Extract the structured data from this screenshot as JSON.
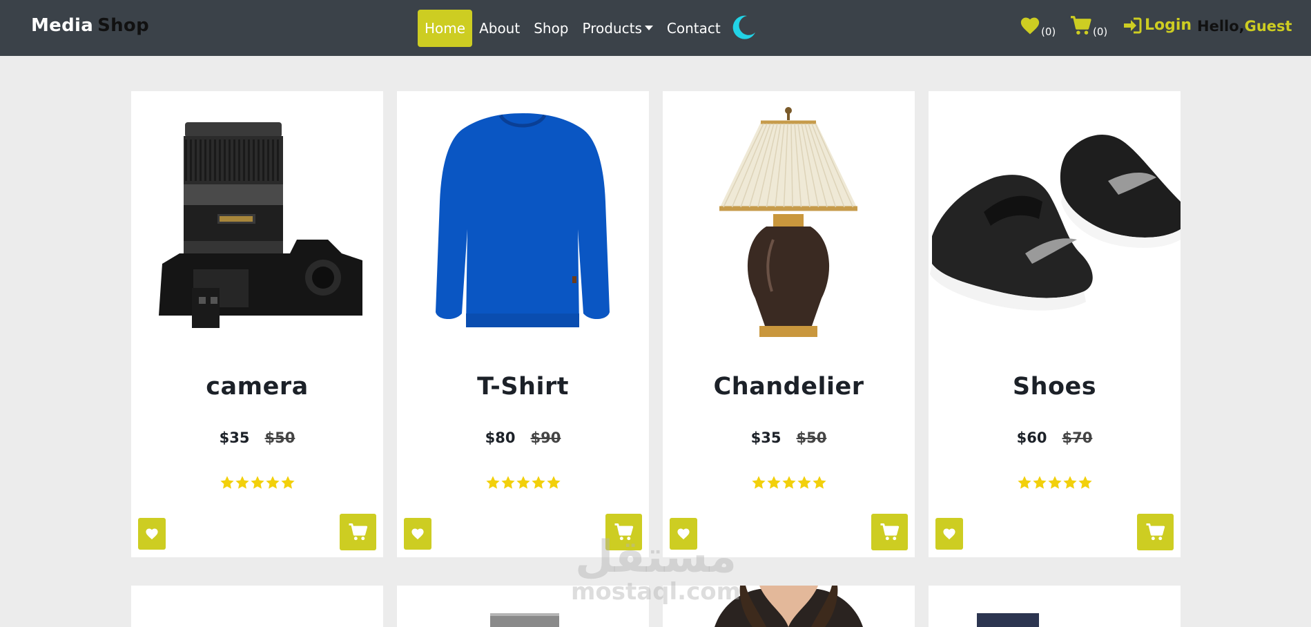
{
  "navbar": {
    "brand_part1": "Media",
    "brand_part2": "Shop",
    "links": [
      {
        "label": "Home",
        "active": true
      },
      {
        "label": "About"
      },
      {
        "label": "Shop"
      },
      {
        "label": "Products",
        "dropdown": true
      },
      {
        "label": "Contact"
      }
    ],
    "theme_icon": "moon-icon",
    "wishlist_count": "(0)",
    "cart_count": "(0)",
    "login_label": "Login",
    "greeting_prefix": "Hello,",
    "greeting_name": "Guest"
  },
  "products": [
    {
      "name": "camera",
      "price": "$35",
      "old_price": "$50",
      "rating": 5,
      "image": "camera"
    },
    {
      "name": "T-Shirt",
      "price": "$80",
      "old_price": "$90",
      "rating": 5,
      "image": "sweater"
    },
    {
      "name": "Chandelier",
      "price": "$35",
      "old_price": "$50",
      "rating": 5,
      "image": "lamp"
    },
    {
      "name": "Shoes",
      "price": "$60",
      "old_price": "$70",
      "rating": 5,
      "image": "shoes"
    }
  ],
  "watermark": {
    "arabic": "مستقل",
    "latin": "mostaql.com"
  },
  "colors": {
    "navbar_bg": "#3b4249",
    "accent": "#cdcd22",
    "star": "#f2d00b",
    "moon": "#22d3e6",
    "page_bg": "#ececec"
  }
}
